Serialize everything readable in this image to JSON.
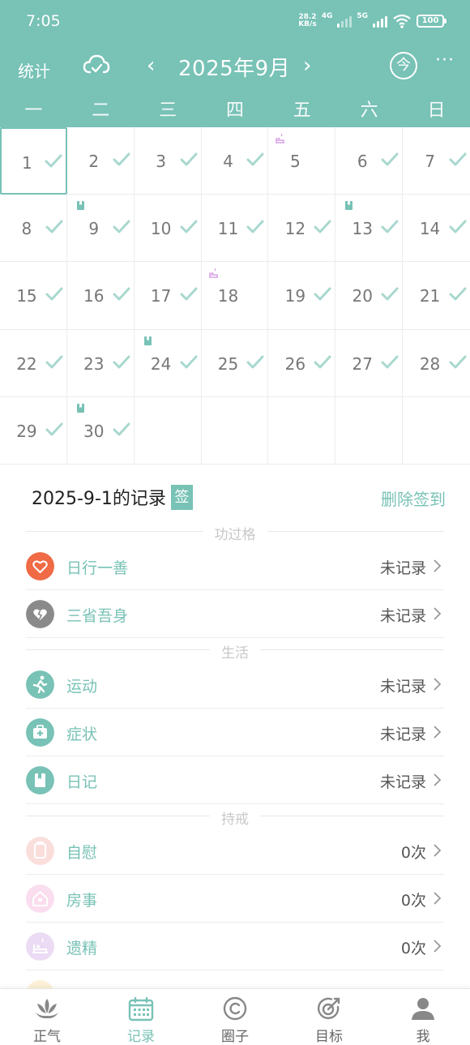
{
  "status_bar": {
    "time": "7:05",
    "speed_top": "28.2",
    "speed_bottom": "KB/s",
    "net1": "4G",
    "net2": "5G",
    "battery": "100"
  },
  "toolbar": {
    "stats_label": "统计",
    "prev": "‹",
    "title": "2025年9月",
    "next": "›",
    "today_label": "今",
    "more": "···"
  },
  "weekdays": [
    "一",
    "二",
    "三",
    "四",
    "五",
    "六",
    "日"
  ],
  "calendar": {
    "days": [
      {
        "d": "1",
        "check": true,
        "selected": true
      },
      {
        "d": "2",
        "check": true
      },
      {
        "d": "3",
        "check": true
      },
      {
        "d": "4",
        "check": true
      },
      {
        "d": "5",
        "check": false,
        "badge": "emission"
      },
      {
        "d": "6",
        "check": true
      },
      {
        "d": "7",
        "check": true
      },
      {
        "d": "8",
        "check": true
      },
      {
        "d": "9",
        "check": true,
        "badge": "diary"
      },
      {
        "d": "10",
        "check": true
      },
      {
        "d": "11",
        "check": true
      },
      {
        "d": "12",
        "check": true
      },
      {
        "d": "13",
        "check": true,
        "badge": "diary"
      },
      {
        "d": "14",
        "check": true
      },
      {
        "d": "15",
        "check": true
      },
      {
        "d": "16",
        "check": true
      },
      {
        "d": "17",
        "check": true
      },
      {
        "d": "18",
        "check": false,
        "badge": "emission"
      },
      {
        "d": "19",
        "check": true
      },
      {
        "d": "20",
        "check": true
      },
      {
        "d": "21",
        "check": true
      },
      {
        "d": "22",
        "check": true
      },
      {
        "d": "23",
        "check": true
      },
      {
        "d": "24",
        "check": true,
        "badge": "diary"
      },
      {
        "d": "25",
        "check": true
      },
      {
        "d": "26",
        "check": true
      },
      {
        "d": "27",
        "check": true
      },
      {
        "d": "28",
        "check": true
      },
      {
        "d": "29",
        "check": true
      },
      {
        "d": "30",
        "check": true,
        "badge": "diary"
      }
    ]
  },
  "record": {
    "heading": "2025-9-1的记录",
    "sign_badge": "签",
    "delete_label": "删除签到"
  },
  "sections": {
    "merit": "功过格",
    "life": "生活",
    "abstain": "持戒"
  },
  "rows": [
    {
      "label": "日行一善",
      "value": "未记录",
      "icon": "heart-icon",
      "color": "#ef6a45"
    },
    {
      "label": "三省吾身",
      "value": "未记录",
      "icon": "broken-heart-icon",
      "color": "#8a8a8a"
    },
    {
      "label": "运动",
      "value": "未记录",
      "icon": "running-icon",
      "color": "#78c2b6"
    },
    {
      "label": "症状",
      "value": "未记录",
      "icon": "medical-kit-icon",
      "color": "#78c2b6"
    },
    {
      "label": "日记",
      "value": "未记录",
      "icon": "diary-icon",
      "color": "#78c2b6"
    },
    {
      "label": "自慰",
      "value": "0次",
      "icon": "cup-icon",
      "color": "#f3a39a"
    },
    {
      "label": "房事",
      "value": "0次",
      "icon": "house-icon",
      "color": "#f2a0cf"
    },
    {
      "label": "遗精",
      "value": "0次",
      "icon": "emission-icon",
      "color": "#c99be0"
    }
  ],
  "tabs": [
    {
      "label": "正气",
      "icon": "lotus-icon"
    },
    {
      "label": "记录",
      "icon": "calendar-icon",
      "active": true
    },
    {
      "label": "圈子",
      "icon": "circle-icon"
    },
    {
      "label": "目标",
      "icon": "target-icon"
    },
    {
      "label": "我",
      "icon": "user-icon"
    }
  ],
  "colors": {
    "accent": "#78c2b6",
    "check": "#a8d8cf",
    "emission_badge": "#d9a3e6",
    "diary_badge": "#78c2b6"
  }
}
